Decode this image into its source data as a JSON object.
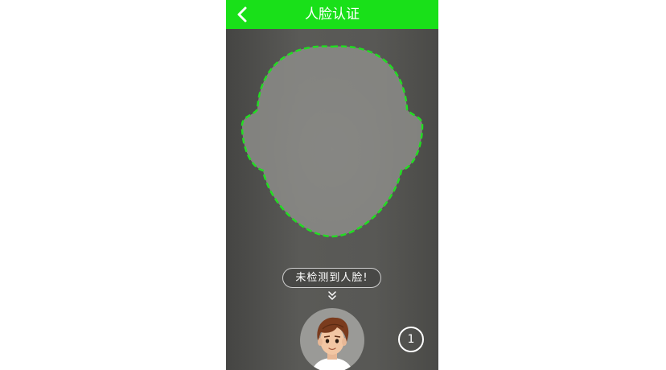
{
  "header": {
    "title": "人脸认证",
    "back_icon": "chevron-left-icon",
    "background_color": "#19e019"
  },
  "camera": {
    "guide_color": "#22dd22",
    "guide_style": "dashed"
  },
  "status": {
    "message": "未检测到人脸!",
    "hint_icon": "double-chevron-down-icon"
  },
  "avatar": {
    "icon": "cartoon-face-avatar-icon"
  },
  "counter": {
    "value": "1"
  }
}
